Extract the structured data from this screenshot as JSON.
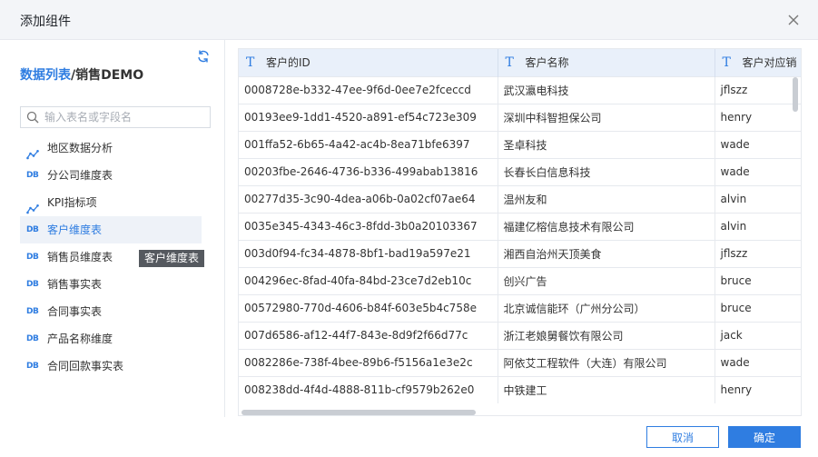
{
  "dialog": {
    "title": "添加组件"
  },
  "left": {
    "breadcrumb": {
      "link": "数据列表",
      "sep": "/",
      "current": "销售DEMO"
    },
    "search_placeholder": "输入表名或字段名",
    "items": [
      {
        "label": "地区数据分析",
        "icon": "analysis-icon"
      },
      {
        "label": "分公司维度表",
        "icon": "db-icon"
      },
      {
        "label": "KPI指标项",
        "icon": "analysis-icon"
      },
      {
        "label": "客户维度表",
        "icon": "db-icon",
        "active": true
      },
      {
        "label": "销售员维度表",
        "icon": "db-icon"
      },
      {
        "label": "销售事实表",
        "icon": "db-icon"
      },
      {
        "label": "合同事实表",
        "icon": "db-icon"
      },
      {
        "label": "产品名称维度",
        "icon": "db-icon"
      },
      {
        "label": "合同回款事实表",
        "icon": "db-icon"
      }
    ],
    "db_icon_text": "DB",
    "tooltip": "客户维度表"
  },
  "table": {
    "columns": [
      {
        "type_icon": "T",
        "label": "客户的ID"
      },
      {
        "type_icon": "T",
        "label": "客户名称"
      },
      {
        "type_icon": "T",
        "label": "客户对应销"
      }
    ],
    "rows": [
      [
        "0008728e-b332-47ee-9f6d-0ee7e2fceccd",
        "武汉瀛电科技",
        "jflszz"
      ],
      [
        "00193ee9-1dd1-4520-a891-ef54c723e309",
        "深圳中科智担保公司",
        "henry"
      ],
      [
        "001ffa52-6b65-4a42-ac4b-8ea71bfe6397",
        "圣卓科技",
        "wade"
      ],
      [
        "00203fbe-2646-4736-b336-499abab13816",
        "长春长白信息科技",
        "wade"
      ],
      [
        "00277d35-3c90-4dea-a06b-0a02cf07ae64",
        "温州友和",
        "alvin"
      ],
      [
        "0035e345-4343-46c3-8fdd-3b0a20103367",
        "福建亿榕信息技术有限公司",
        "alvin"
      ],
      [
        "003d0f94-fc34-4878-8bf1-bad19a597e21",
        "湘西自治州天顶美食",
        "jflszz"
      ],
      [
        "004296ec-8fad-40fa-84bd-23ce7d2eb10c",
        "创兴广告",
        "bruce"
      ],
      [
        "00572980-770d-4606-b84f-603e5b4c758e",
        "北京诚信能环（广州分公司）",
        "bruce"
      ],
      [
        "007d6586-af12-44f7-843e-8d9f2f66d77c",
        "浙江老娘舅餐饮有限公司",
        "jack"
      ],
      [
        "0082286e-738f-4bee-89b6-f5156a1e3e2c",
        "阿依艾工程软件（大连）有限公司",
        "wade"
      ],
      [
        "008238dd-4f4d-4888-811b-cf9579b262e0",
        "中铁建工",
        "henry"
      ]
    ]
  },
  "footer": {
    "cancel": "取消",
    "ok": "确定"
  },
  "colors": {
    "accent": "#2f7de1",
    "header_bg": "#f3f5f8",
    "table_header_bg": "#e9f0fa",
    "active_item_bg": "#eef2f8",
    "tooltip_bg": "#55595f"
  }
}
